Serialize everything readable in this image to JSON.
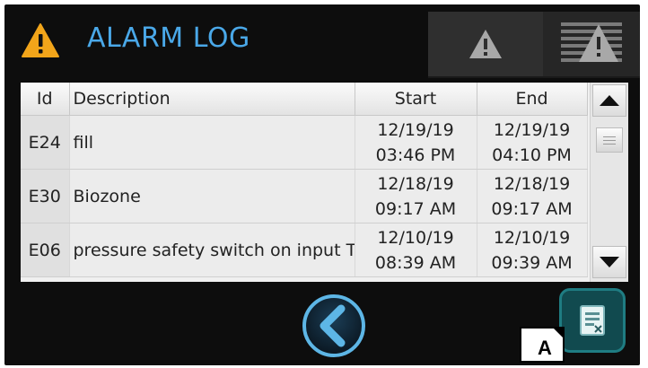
{
  "header": {
    "title": "ALARM LOG",
    "icons": {
      "title_icon": "warning-triangle-icon",
      "active_tab_icon": "warning-triangle-icon",
      "history_tab_icon": "warning-list-icon"
    }
  },
  "table": {
    "columns": [
      "Id",
      "Description",
      "Start",
      "End"
    ],
    "rows": [
      {
        "id": "E24",
        "description": "fill",
        "start_date": "12/19/19",
        "start_time": "03:46 PM",
        "end_date": "12/19/19",
        "end_time": "04:10 PM"
      },
      {
        "id": "E30",
        "description": "Biozone",
        "start_date": "12/18/19",
        "start_time": "09:17 AM",
        "end_date": "12/18/19",
        "end_time": "09:17 AM"
      },
      {
        "id": "E06",
        "description": "pressure safety switch on input T",
        "start_date": "12/10/19",
        "start_time": "08:39 AM",
        "end_date": "12/10/19",
        "end_time": "09:39 AM"
      }
    ]
  },
  "footer": {
    "back_icon": "chevron-left-icon",
    "export_icon": "export-document-icon",
    "callout_label": "A"
  },
  "colors": {
    "title": "#4aa8e8",
    "warning": "#f2a51a",
    "accent": "#1f7c82"
  }
}
